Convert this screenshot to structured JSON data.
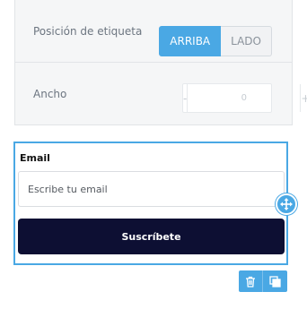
{
  "settings": {
    "label_position": {
      "label": "Posición de etiqueta",
      "options": [
        "ARRIBA",
        "LADO"
      ],
      "selected": "ARRIBA"
    },
    "width": {
      "label": "Ancho",
      "minus": "-",
      "value": "0",
      "plus": "+"
    }
  },
  "form": {
    "email_label": "Email",
    "email_placeholder": "Escribe tu email",
    "email_value": "",
    "subscribe_label": "Suscríbete"
  },
  "icons": {
    "move": "move-arrows-icon",
    "delete": "trash-icon",
    "duplicate": "copy-icon"
  },
  "colors": {
    "accent": "#4aa8e4",
    "button_dark": "#0d0f33",
    "panel_bg": "#f5f6f7"
  }
}
